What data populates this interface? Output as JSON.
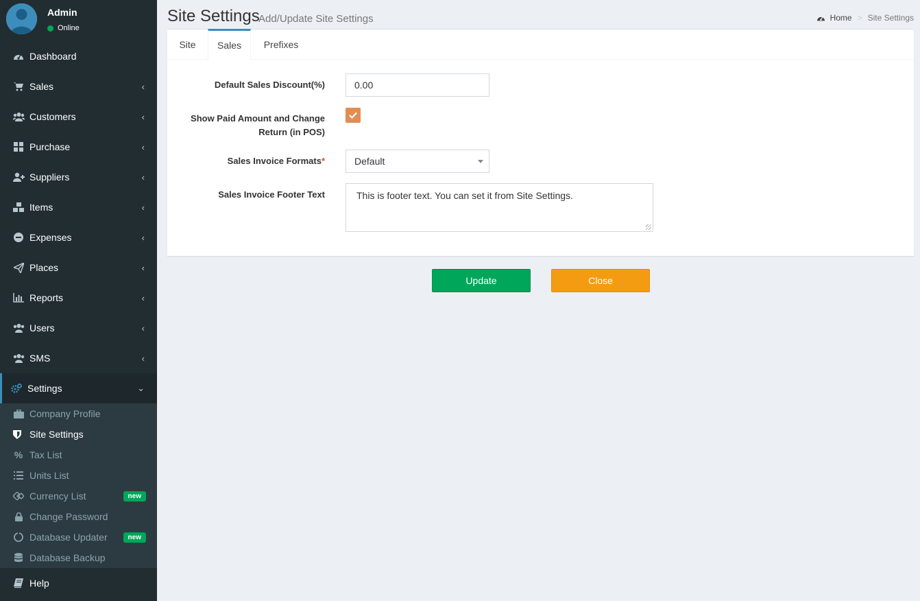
{
  "user": {
    "name": "Admin",
    "status": "Online"
  },
  "menu": [
    {
      "label": "Dashboard",
      "icon": "dashboard-icon",
      "arrow": ""
    },
    {
      "label": "Sales",
      "icon": "cart-icon",
      "arrow": "‹"
    },
    {
      "label": "Customers",
      "icon": "users-icon",
      "arrow": "‹"
    },
    {
      "label": "Purchase",
      "icon": "grid-icon",
      "arrow": "‹"
    },
    {
      "label": "Suppliers",
      "icon": "user-plus-icon",
      "arrow": "‹"
    },
    {
      "label": "Items",
      "icon": "cubes-icon",
      "arrow": "‹"
    },
    {
      "label": "Expenses",
      "icon": "minus-circle-icon",
      "arrow": "‹"
    },
    {
      "label": "Places",
      "icon": "paper-plane-icon",
      "arrow": "‹"
    },
    {
      "label": "Reports",
      "icon": "bar-chart-icon",
      "arrow": "‹"
    },
    {
      "label": "Users",
      "icon": "users-icon",
      "arrow": "‹"
    },
    {
      "label": "SMS",
      "icon": "users-icon",
      "arrow": "‹"
    },
    {
      "label": "Settings",
      "icon": "cogs-icon",
      "arrow": "⌄"
    },
    {
      "label": "Help",
      "icon": "book-icon",
      "arrow": ""
    }
  ],
  "submenu": [
    {
      "label": "Company Profile",
      "icon": "suitcase-icon",
      "badge": ""
    },
    {
      "label": "Site Settings",
      "icon": "shield-icon",
      "badge": ""
    },
    {
      "label": "Tax List",
      "icon": "percent-icon",
      "badge": ""
    },
    {
      "label": "Units List",
      "icon": "list-icon",
      "badge": ""
    },
    {
      "label": "Currency List",
      "icon": "gem-icon",
      "badge": "new"
    },
    {
      "label": "Change Password",
      "icon": "lock-icon",
      "badge": ""
    },
    {
      "label": "Database Updater",
      "icon": "circle-notch-icon",
      "badge": "new"
    },
    {
      "label": "Database Backup",
      "icon": "database-icon",
      "badge": ""
    }
  ],
  "header": {
    "title": "Site Settings",
    "subtitle": "Add/Update Site Settings"
  },
  "breadcrumb": {
    "home": "Home",
    "separator": ">",
    "current": "Site Settings"
  },
  "tabs": [
    "Site",
    "Sales",
    "Prefixes"
  ],
  "form": {
    "discount_label": "Default Sales Discount(%)",
    "discount_value": "0.00",
    "paid_label_line1": "Show Paid Amount and Change",
    "paid_label_line2": "Return (in POS)",
    "paid_checked": true,
    "format_label": "Sales Invoice Formats",
    "format_required": "*",
    "format_value": "Default",
    "footer_label": "Sales Invoice Footer Text",
    "footer_value": "This is footer text. You can set it from Site Settings."
  },
  "buttons": {
    "update": "Update",
    "close": "Close"
  },
  "colors": {
    "sidebar": "#222d32",
    "accent": "#3c8dbc",
    "update": "#00a65a",
    "close": "#f39c12",
    "checkbox": "#e08e54"
  }
}
